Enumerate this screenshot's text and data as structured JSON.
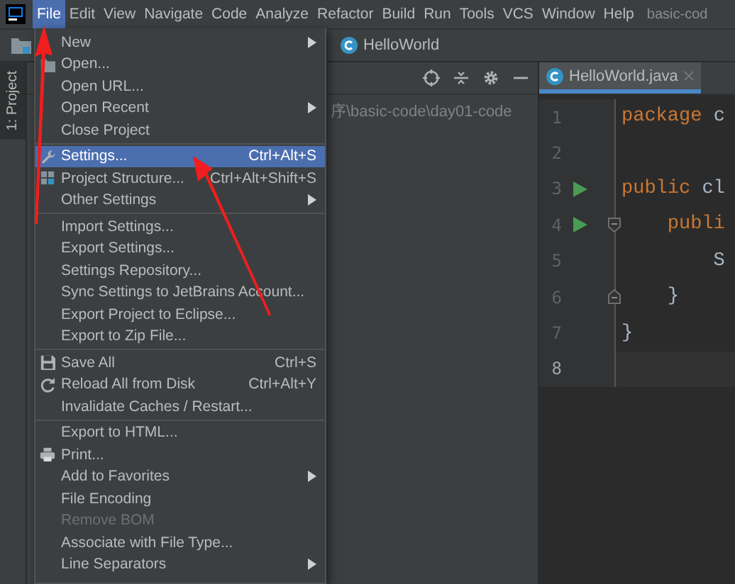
{
  "menu_bar": {
    "items": [
      {
        "label": "File",
        "selected": true
      },
      {
        "label": "Edit",
        "selected": false
      },
      {
        "label": "View",
        "selected": false
      },
      {
        "label": "Navigate",
        "selected": false
      },
      {
        "label": "Code",
        "selected": false
      },
      {
        "label": "Analyze",
        "selected": false
      },
      {
        "label": "Refactor",
        "selected": false
      },
      {
        "label": "Build",
        "selected": false
      },
      {
        "label": "Run",
        "selected": false
      },
      {
        "label": "Tools",
        "selected": false
      },
      {
        "label": "VCS",
        "selected": false
      },
      {
        "label": "Window",
        "selected": false
      },
      {
        "label": "Help",
        "selected": false
      }
    ],
    "title": "basic-cod"
  },
  "navigation_bar": {
    "file": "HelloWorld"
  },
  "tool_strip": {
    "label": "1: Project",
    "selected": true
  },
  "project_panel": {
    "path": "序\\basic-code\\day01-code"
  },
  "editor": {
    "tab": {
      "label": "HelloWorld.java",
      "selected": true
    },
    "lines": [
      {
        "number": "1",
        "tokens": [
          {
            "kind": "keyword",
            "text": "package"
          },
          {
            "kind": "plain",
            "text": " c"
          }
        ],
        "run": false,
        "fold_start": false,
        "fold_end": false,
        "current": false
      },
      {
        "number": "2",
        "run": false,
        "fold_start": false,
        "fold_end": false,
        "current": false
      },
      {
        "number": "3",
        "tokens": [
          {
            "kind": "keyword",
            "text": "public"
          },
          {
            "kind": "plain",
            "text": " cl"
          }
        ],
        "run": true,
        "fold_start": false,
        "fold_end": false,
        "current": false
      },
      {
        "number": "4",
        "tokens": [
          {
            "kind": "keyword",
            "text": "    publi"
          }
        ],
        "run": true,
        "fold_start": true,
        "fold_end": false,
        "current": false
      },
      {
        "number": "5",
        "tokens": [
          {
            "kind": "plain",
            "text": "        S"
          }
        ],
        "run": false,
        "fold_start": false,
        "fold_end": false,
        "current": false
      },
      {
        "number": "6",
        "tokens": [
          {
            "kind": "plain",
            "text": "    }"
          }
        ],
        "run": false,
        "fold_start": false,
        "fold_end": true,
        "current": false
      },
      {
        "number": "7",
        "tokens": [
          {
            "kind": "plain",
            "text": "}"
          }
        ],
        "run": false,
        "fold_start": false,
        "fold_end": false,
        "current": false
      },
      {
        "number": "8",
        "run": false,
        "fold_start": false,
        "fold_end": false,
        "current": true
      }
    ]
  },
  "file_menu": {
    "items": [
      {
        "kind": "item",
        "label": "New",
        "submenu": true,
        "selected": false,
        "disabled": false
      },
      {
        "kind": "open",
        "label": "Open...",
        "submenu": false,
        "selected": false,
        "disabled": false
      },
      {
        "kind": "item",
        "label": "Open URL...",
        "submenu": false,
        "selected": false,
        "disabled": false
      },
      {
        "kind": "item",
        "label": "Open Recent",
        "submenu": true,
        "selected": false,
        "disabled": false
      },
      {
        "kind": "item",
        "label": "Close Project",
        "submenu": false,
        "selected": false,
        "disabled": false
      },
      {
        "kind": "separator"
      },
      {
        "kind": "settings",
        "label": "Settings...",
        "shortcut": "Ctrl+Alt+S",
        "submenu": false,
        "selected": true,
        "disabled": false
      },
      {
        "kind": "structure",
        "label": "Project Structure...",
        "shortcut": "Ctrl+Alt+Shift+S",
        "submenu": false,
        "selected": false,
        "disabled": false
      },
      {
        "kind": "item",
        "label": "Other Settings",
        "submenu": true,
        "selected": false,
        "disabled": false
      },
      {
        "kind": "separator"
      },
      {
        "kind": "item",
        "label": "Import Settings...",
        "submenu": false,
        "selected": false,
        "disabled": false
      },
      {
        "kind": "item",
        "label": "Export Settings...",
        "submenu": false,
        "selected": false,
        "disabled": false
      },
      {
        "kind": "item",
        "label": "Settings Repository...",
        "submenu": false,
        "selected": false,
        "disabled": false
      },
      {
        "kind": "item",
        "label": "Sync Settings to JetBrains Account...",
        "submenu": false,
        "selected": false,
        "disabled": false
      },
      {
        "kind": "item",
        "label": "Export Project to Eclipse...",
        "submenu": false,
        "selected": false,
        "disabled": false
      },
      {
        "kind": "item",
        "label": "Export to Zip File...",
        "submenu": false,
        "selected": false,
        "disabled": false
      },
      {
        "kind": "separator"
      },
      {
        "kind": "save",
        "label": "Save All",
        "shortcut": "Ctrl+S",
        "submenu": false,
        "selected": false,
        "disabled": false
      },
      {
        "kind": "reload",
        "label": "Reload All from Disk",
        "shortcut": "Ctrl+Alt+Y",
        "submenu": false,
        "selected": false,
        "disabled": false
      },
      {
        "kind": "item",
        "label": "Invalidate Caches / Restart...",
        "submenu": false,
        "selected": false,
        "disabled": false
      },
      {
        "kind": "separator"
      },
      {
        "kind": "item",
        "label": "Export to HTML...",
        "submenu": false,
        "selected": false,
        "disabled": false
      },
      {
        "kind": "print",
        "label": "Print...",
        "submenu": false,
        "selected": false,
        "disabled": false
      },
      {
        "kind": "item",
        "label": "Add to Favorites",
        "submenu": true,
        "selected": false,
        "disabled": false
      },
      {
        "kind": "item",
        "label": "File Encoding",
        "submenu": false,
        "selected": false,
        "disabled": false
      },
      {
        "kind": "item",
        "label": "Remove BOM",
        "submenu": false,
        "selected": false,
        "disabled": true
      },
      {
        "kind": "item",
        "label": "Associate with File Type...",
        "submenu": false,
        "selected": false,
        "disabled": false
      },
      {
        "kind": "item",
        "label": "Line Separators",
        "submenu": true,
        "selected": false,
        "disabled": false
      }
    ]
  }
}
